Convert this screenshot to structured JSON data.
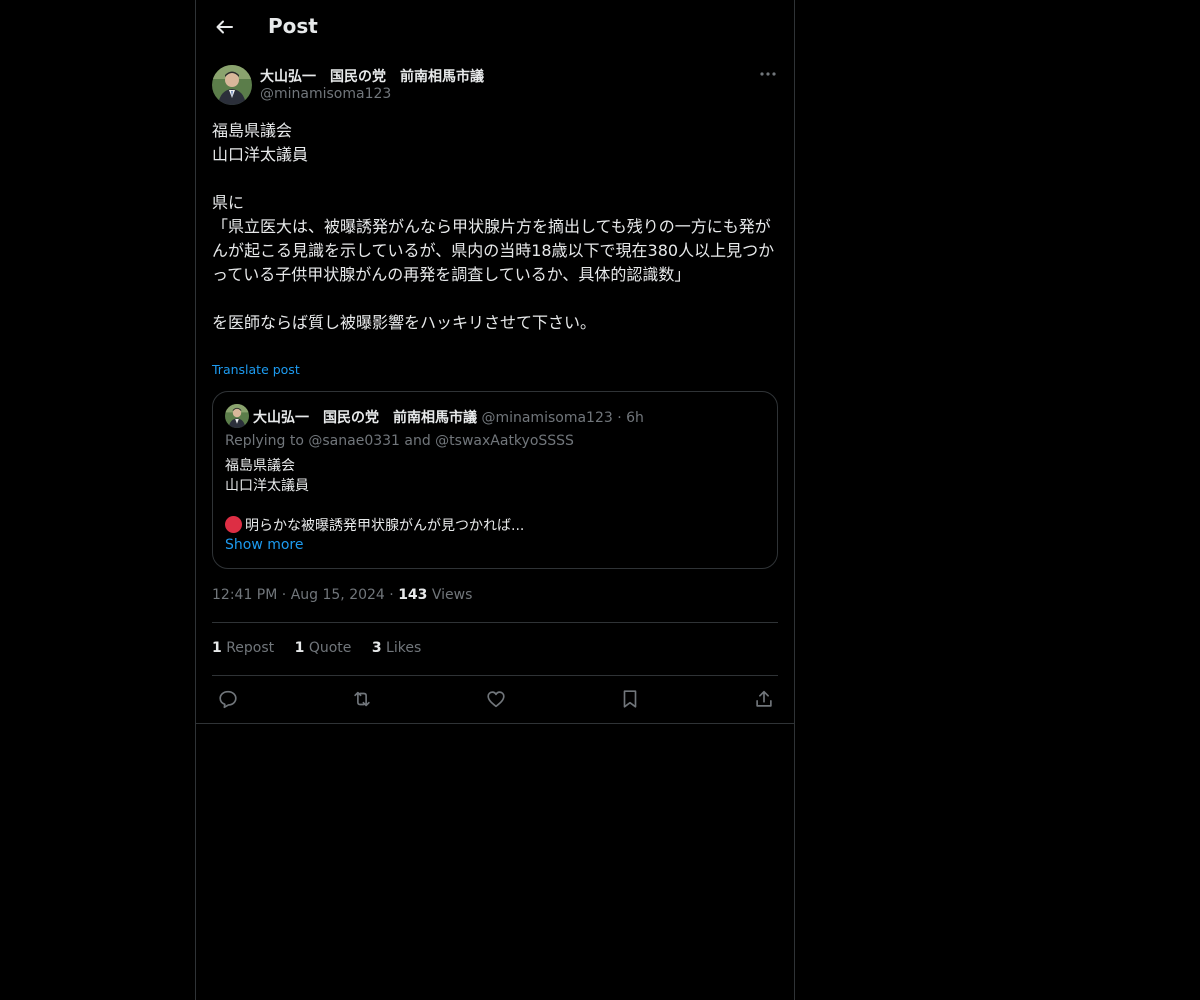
{
  "header": {
    "title": "Post"
  },
  "author": {
    "name": "大山弘一　国民の党　前南相馬市議",
    "handle": "@minamisoma123"
  },
  "post": {
    "text": "福島県議会\n山口洋太議員\n\n県に\n「県立医大は、被曝誘発がんなら甲状腺片方を摘出しても残りの一方にも発がんが起こる見識を示しているが、県内の当時18歳以下で現在380人以上見つかっている子供甲状腺がんの再発を調査しているか、具体的認識数」\n\nを医師ならば質し被曝影響をハッキリさせて下さい。",
    "translate_label": "Translate post",
    "time": "12:41 PM",
    "date": "Aug 15, 2024",
    "views_count": "143",
    "views_label": "Views"
  },
  "quote": {
    "name": "大山弘一　国民の党　前南相馬市議",
    "handle": "@minamisoma123",
    "time": "6h",
    "replying": "Replying to @sanae0331 and @tswaxAatkyoSSSS",
    "text_lines": "福島県議会\n山口洋太議員\n",
    "last_line": "明らかな被曝誘発甲状腺がんが見つかれば...",
    "show_more": "Show more"
  },
  "stats": {
    "reposts_count": "1",
    "reposts_label": "Repost",
    "quotes_count": "1",
    "quotes_label": "Quote",
    "likes_count": "3",
    "likes_label": "Likes"
  },
  "colors": {
    "background": "#000000",
    "text": "#e7e9ea",
    "secondary_text": "#71767b",
    "accent": "#1d9bf0",
    "border": "#2f3336",
    "red_circle": "#dd2e44"
  },
  "icons": [
    "back-arrow-icon",
    "more-icon",
    "reply-icon",
    "repost-icon",
    "like-icon",
    "bookmark-icon",
    "share-icon"
  ]
}
